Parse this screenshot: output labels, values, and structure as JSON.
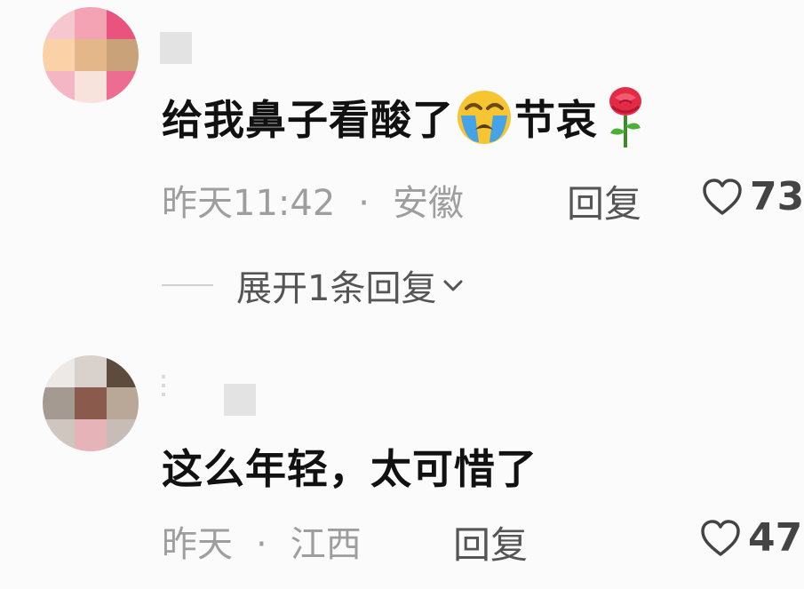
{
  "comments": [
    {
      "text": "给我鼻子看酸了",
      "text_after_emoji": "节哀",
      "emoji_1": "loudly-crying-face",
      "emoji_2": "rose",
      "time": "昨天11:42",
      "separator": "·",
      "location": "安徽",
      "reply_label": "回复",
      "likes": "73",
      "expand_label": "展开1条回复"
    },
    {
      "text": "这么年轻，太可惜了",
      "time": "昨天",
      "separator": "·",
      "location": "江西",
      "reply_label": "回复",
      "likes": "47"
    }
  ],
  "icons": {
    "like": "heart-outline-icon",
    "expand": "chevron-down-icon"
  },
  "colors": {
    "background": "#fbfbfb",
    "text": "#111111",
    "meta": "#9e9e9e",
    "action": "#555555"
  }
}
